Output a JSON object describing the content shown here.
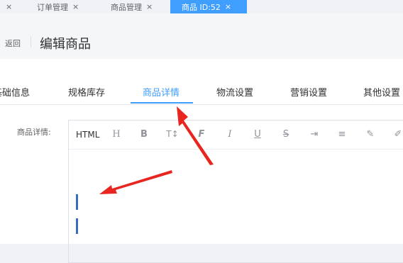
{
  "tabs": [
    {
      "label": "订单管理"
    },
    {
      "label": "商品管理"
    },
    {
      "label": "商品 ID:52"
    }
  ],
  "tab_close": "×",
  "page": {
    "back": "返回",
    "title": "编辑商品"
  },
  "subtabs": [
    "基础信息",
    "规格库存",
    "商品详情",
    "物流设置",
    "营销设置",
    "其他设置"
  ],
  "form": {
    "label": "商品详情:"
  },
  "toolbar": {
    "html": "HTML",
    "icons": [
      "heading-icon",
      "bold-icon",
      "font-size-icon",
      "font-icon",
      "italic-icon",
      "underline-icon",
      "strikethrough-icon",
      "indent-icon",
      "line-height-icon",
      "brush-icon",
      "color-icon"
    ],
    "glyphs": {
      "heading": "H",
      "bold": "B",
      "font_size": "T↕",
      "font": "F",
      "italic": "I",
      "underline": "U",
      "strike": "S",
      "indent": "⇥",
      "lineheight": "≡",
      "brush": "✎",
      "color": "✐"
    }
  },
  "colors": {
    "accent": "#409eff",
    "annotation": "#e8251f"
  }
}
